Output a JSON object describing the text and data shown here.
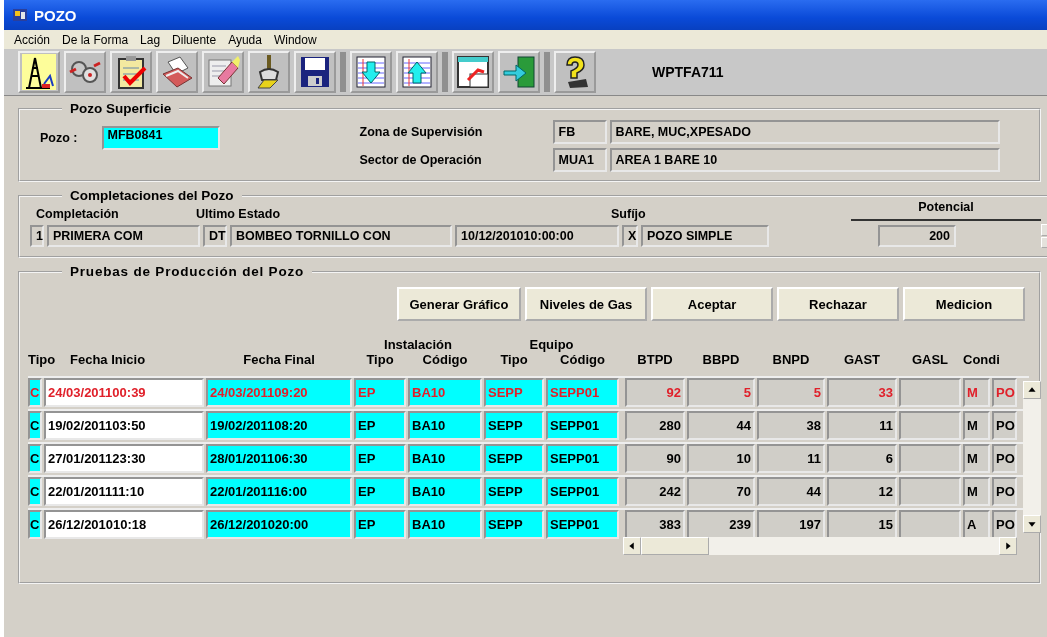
{
  "window": {
    "title": "POZO"
  },
  "menu": [
    "Acción",
    "De la Forma",
    "Lag",
    "Diluente",
    "Ayuda",
    "Window"
  ],
  "toolbar": {
    "form_code": "WPTFA711"
  },
  "pozo_superficie": {
    "title": "Pozo Superficie",
    "pozo_label": "Pozo :",
    "pozo": "MFB0841",
    "fields": [
      {
        "label": "Zona de Supervisión",
        "code": "FB",
        "value": "BARE, MUC,XPESADO"
      },
      {
        "label": "Sector de Operación",
        "code": "MUA1",
        "value": "AREA 1 BARE 10"
      }
    ]
  },
  "completaciones": {
    "title": "Completaciones del Pozo",
    "headers": {
      "completacion": "Completación",
      "ultimo_estado": "Ultimo Estado",
      "sufijo": "Sufíjo",
      "potencial": "Potencial"
    },
    "row": {
      "numero": "1",
      "completacion": "PRIMERA COM",
      "estado_codigo": "DT",
      "estado": "BOMBEO TORNILLO CON",
      "fecha": "10/12/201010:00:00",
      "sufijo_codigo": "X",
      "sufijo": "POZO SIMPLE",
      "potencial": "200"
    }
  },
  "pruebas": {
    "title": "Pruebas de Producción del Pozo",
    "buttons": [
      "Generar Gráfico",
      "Niveles de Gas",
      "Aceptar",
      "Rechazar",
      "Medicion"
    ],
    "column_groups": [
      {
        "label": "Instalación"
      },
      {
        "label": "Equipo"
      }
    ],
    "columns": [
      {
        "label": "Tipo",
        "kind": "key"
      },
      {
        "label": "Fecha Inicio",
        "kind": "entry"
      },
      {
        "label": "Fecha Final",
        "kind": "code"
      },
      {
        "label": "Tipo",
        "kind": "code",
        "grouped": true,
        "group_start": true
      },
      {
        "label": "Código",
        "kind": "code",
        "grouped": true
      },
      {
        "label": "Tipo",
        "kind": "code",
        "grouped": true,
        "group_start": true
      },
      {
        "label": "Código",
        "kind": "code",
        "grouped": true
      },
      {
        "label": "BTPD",
        "kind": "number"
      },
      {
        "label": "BBPD",
        "kind": "number"
      },
      {
        "label": "BNPD",
        "kind": "number"
      },
      {
        "label": "GAST",
        "kind": "number"
      },
      {
        "label": "GASL",
        "kind": "number"
      },
      {
        "label": "Condi",
        "kind": "text"
      },
      {
        "kind": "text"
      }
    ],
    "rows": [
      {
        "selected": true,
        "cells": [
          "C",
          "24/03/201100:39",
          "24/03/201109:20",
          "EP",
          "BA10",
          "SEPP",
          "SEPP01",
          "92",
          "5",
          "5",
          "33",
          null,
          "M",
          "PO"
        ]
      },
      {
        "selected": false,
        "cells": [
          "C",
          "19/02/201103:50",
          "19/02/201108:20",
          "EP",
          "BA10",
          "SEPP",
          "SEPP01",
          "280",
          "44",
          "38",
          "11",
          null,
          "M",
          "PO"
        ]
      },
      {
        "selected": false,
        "cells": [
          "C",
          "27/01/201123:30",
          "28/01/201106:30",
          "EP",
          "BA10",
          "SEPP",
          "SEPP01",
          "90",
          "10",
          "11",
          "6",
          null,
          "M",
          "PO"
        ]
      },
      {
        "selected": false,
        "cells": [
          "C",
          "22/01/201111:10",
          "22/01/201116:00",
          "EP",
          "BA10",
          "SEPP",
          "SEPP01",
          "242",
          "70",
          "44",
          "12",
          null,
          "M",
          "PO"
        ]
      },
      {
        "selected": false,
        "cells": [
          "C",
          "26/12/201010:18",
          "26/12/201020:00",
          "EP",
          "BA10",
          "SEPP",
          "SEPP01",
          "383",
          "239",
          "197",
          "15",
          null,
          "A",
          "PO"
        ]
      }
    ]
  }
}
